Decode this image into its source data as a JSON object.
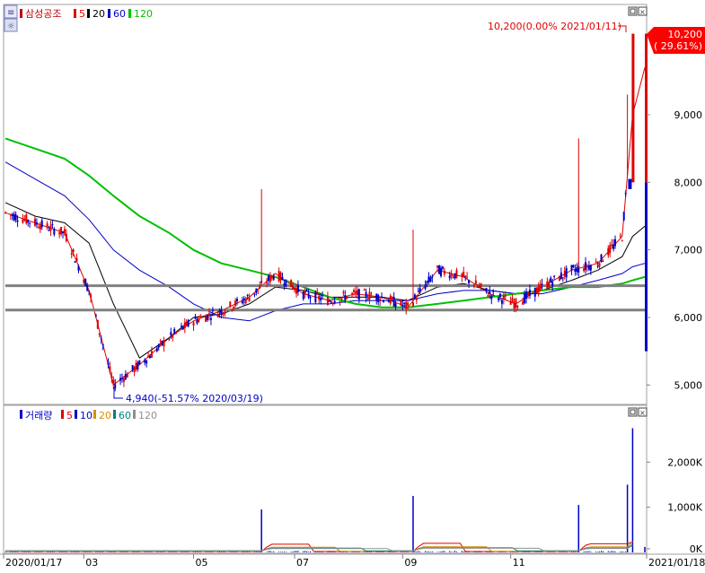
{
  "stock": {
    "name": "삼성공조",
    "ma": [
      {
        "label": "5",
        "color": "#e00000"
      },
      {
        "label": "20",
        "color": "#000000"
      },
      {
        "label": "60",
        "color": "#0000c8"
      },
      {
        "label": "120",
        "color": "#00c000"
      }
    ],
    "hi_annotation": "10,200(0.00% 2021/01/11)",
    "lo_annotation": "4,940(-51.57% 2020/03/19)",
    "current_price": "10,200",
    "current_change": "( 29.61%)"
  },
  "volume": {
    "name": "거래량",
    "ma": [
      {
        "label": "5",
        "color": "#e00000"
      },
      {
        "label": "10",
        "color": "#0000c8"
      },
      {
        "label": "20",
        "color": "#d89000"
      },
      {
        "label": "60",
        "color": "#008080"
      },
      {
        "label": "120",
        "color": "#909090"
      }
    ]
  },
  "colors": {
    "up": "#e00000",
    "down": "#0000c8",
    "ma5": "#e00000",
    "ma20": "#000000",
    "ma60": "#0000c8",
    "ma120": "#00c000",
    "hline": "#808080"
  },
  "chart_data": [
    {
      "type": "line",
      "title": "삼성공조",
      "ylim": [
        4800,
        10400
      ],
      "yticks": [
        "9,000",
        "8,000",
        "7,000",
        "6,000",
        "5,000"
      ],
      "ytick_values": [
        9000,
        8000,
        7000,
        6000,
        5000
      ],
      "xticks": [
        "2020/01/17",
        "03",
        "05",
        "07",
        "09",
        "11",
        "2021/01/18"
      ],
      "horizontal_lines": [
        6470,
        6110
      ],
      "series": [
        {
          "name": "5",
          "x": [
            "2020/01/17",
            "2020/02/03",
            "2020/02/20",
            "2020/03/05",
            "2020/03/19",
            "2020/04/03",
            "2020/04/20",
            "2020/05/04",
            "2020/05/20",
            "2020/06/05",
            "2020/06/20",
            "2020/07/06",
            "2020/07/21",
            "2020/08/05",
            "2020/08/20",
            "2020/09/04",
            "2020/09/21",
            "2020/10/06",
            "2020/10/21",
            "2020/11/05",
            "2020/11/20",
            "2020/12/07",
            "2020/12/22",
            "2021/01/05",
            "2021/01/11",
            "2021/01/18"
          ],
          "values": [
            7550,
            7400,
            7250,
            6400,
            5000,
            5300,
            5700,
            5950,
            6100,
            6300,
            6650,
            6350,
            6250,
            6350,
            6300,
            6150,
            6700,
            6600,
            6350,
            6200,
            6450,
            6700,
            6800,
            7200,
            9000,
            9700
          ]
        },
        {
          "name": "20",
          "x": [
            "2020/01/17",
            "2020/02/03",
            "2020/02/20",
            "2020/03/05",
            "2020/03/19",
            "2020/04/03",
            "2020/04/20",
            "2020/05/04",
            "2020/05/20",
            "2020/06/05",
            "2020/06/20",
            "2020/07/06",
            "2020/07/21",
            "2020/08/05",
            "2020/08/20",
            "2020/09/04",
            "2020/09/21",
            "2020/10/06",
            "2020/10/21",
            "2020/11/05",
            "2020/11/20",
            "2020/12/07",
            "2020/12/22",
            "2021/01/05",
            "2021/01/11",
            "2021/01/18"
          ],
          "values": [
            7700,
            7500,
            7400,
            7100,
            6200,
            5400,
            5700,
            6000,
            6050,
            6200,
            6450,
            6400,
            6300,
            6300,
            6300,
            6250,
            6450,
            6500,
            6400,
            6350,
            6400,
            6550,
            6700,
            6900,
            7200,
            7350
          ]
        },
        {
          "name": "60",
          "x": [
            "2020/01/17",
            "2020/02/03",
            "2020/02/20",
            "2020/03/05",
            "2020/03/19",
            "2020/04/03",
            "2020/04/20",
            "2020/05/04",
            "2020/05/20",
            "2020/06/05",
            "2020/06/20",
            "2020/07/06",
            "2020/07/21",
            "2020/08/05",
            "2020/08/20",
            "2020/09/04",
            "2020/09/21",
            "2020/10/06",
            "2020/10/21",
            "2020/11/05",
            "2020/11/20",
            "2020/12/07",
            "2020/12/22",
            "2021/01/05",
            "2021/01/11",
            "2021/01/18"
          ],
          "values": [
            8300,
            8050,
            7800,
            7450,
            7000,
            6700,
            6450,
            6200,
            6000,
            5950,
            6100,
            6200,
            6200,
            6250,
            6250,
            6250,
            6350,
            6400,
            6400,
            6350,
            6350,
            6450,
            6550,
            6650,
            6750,
            6800
          ]
        },
        {
          "name": "120",
          "x": [
            "2020/01/17",
            "2020/02/03",
            "2020/02/20",
            "2020/03/05",
            "2020/03/19",
            "2020/04/03",
            "2020/04/20",
            "2020/05/04",
            "2020/05/20",
            "2020/06/05",
            "2020/06/20",
            "2020/07/06",
            "2020/07/21",
            "2020/08/05",
            "2020/08/20",
            "2020/09/04",
            "2020/09/21",
            "2020/10/06",
            "2020/10/21",
            "2020/11/05",
            "2020/11/20",
            "2020/12/07",
            "2020/12/22",
            "2021/01/05",
            "2021/01/11",
            "2021/01/18"
          ],
          "values": [
            8650,
            8500,
            8350,
            8100,
            7800,
            7500,
            7250,
            7000,
            6800,
            6700,
            6600,
            6450,
            6300,
            6200,
            6150,
            6150,
            6200,
            6250,
            6300,
            6350,
            6400,
            6450,
            6450,
            6500,
            6550,
            6600
          ]
        }
      ]
    },
    {
      "type": "bar",
      "title": "거래량",
      "ylim": [
        0,
        2900
      ],
      "ytick_labels": [
        "2,000K",
        "1,000K",
        "0K"
      ],
      "ytick_values": [
        2000,
        1000,
        0
      ],
      "unit": "K",
      "series": [
        {
          "name": "거래량",
          "x": [
            "2020/06/12",
            "2020/09/07",
            "2020/12/11",
            "2021/01/08",
            "2021/01/11",
            "2021/01/18"
          ],
          "values": [
            950,
            1250,
            1050,
            1500,
            2750,
            120
          ]
        }
      ]
    }
  ]
}
